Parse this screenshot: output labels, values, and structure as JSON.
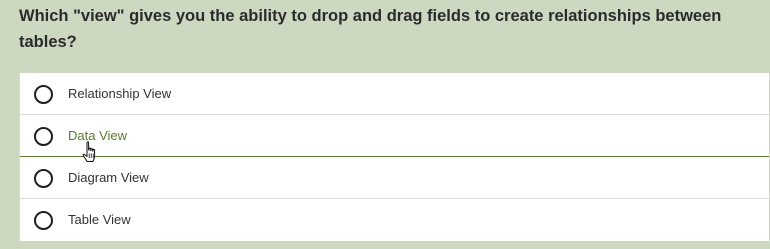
{
  "question": {
    "text": "Which \"view\" gives you the ability to drop and drag fields to create relationships between tables?"
  },
  "options": [
    {
      "label": "Relationship View",
      "selected": false
    },
    {
      "label": "Data View",
      "selected": false,
      "hovered": true
    },
    {
      "label": "Diagram View",
      "selected": false
    },
    {
      "label": "Table View",
      "selected": false
    }
  ],
  "colors": {
    "background": "#cdd8c0",
    "hover_text": "#5a7a2e",
    "hover_border": "#5f7d3a"
  },
  "cursor": {
    "icon": "hand-pointer-icon"
  }
}
